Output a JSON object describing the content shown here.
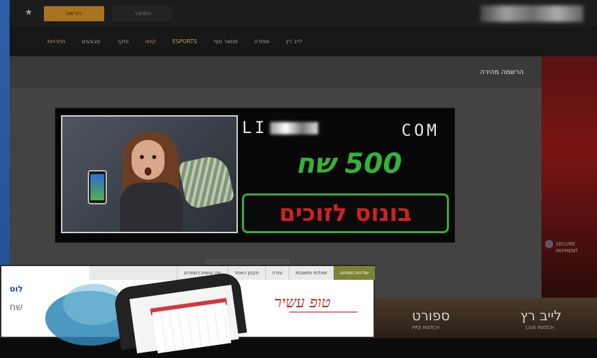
{
  "topbar": {
    "primary_button": "הירשם",
    "secondary_button": "התחבר"
  },
  "nav": {
    "items": [
      "לייב רץ",
      "ספורט",
      "סטאר סוף",
      "ESPORTS",
      "קזינו",
      "פוקר",
      "מבצעים",
      "תחרויות"
    ]
  },
  "modal": {
    "title": "הרשמה מהירה"
  },
  "banner": {
    "domain_suffix": "COM",
    "amount_text": "500 שח",
    "bonus_text": "בונוס לזוכים"
  },
  "secure": {
    "label_1": "SECURE",
    "label_2": "PAYMENT"
  },
  "inset": {
    "nav_items": [
      "שליחת טפסים",
      "שאלות ותשובות",
      "עזרה",
      "תקנון האתר",
      "מה עושים כשזוכים"
    ],
    "brand": "טופ עשיר",
    "text_1": "לוט",
    "text_2": "שח"
  },
  "bottom_tiles": {
    "tile_1": "לייב רץ",
    "tile_1_sub": "LIVE MATCH",
    "tile_2": "ספורט",
    "tile_2_sub": "PRE MATCH"
  },
  "colors": {
    "accent_gold": "#a8731e",
    "bonus_green": "#35b235",
    "bonus_red": "#d32020",
    "brand_red": "#c4242d"
  }
}
